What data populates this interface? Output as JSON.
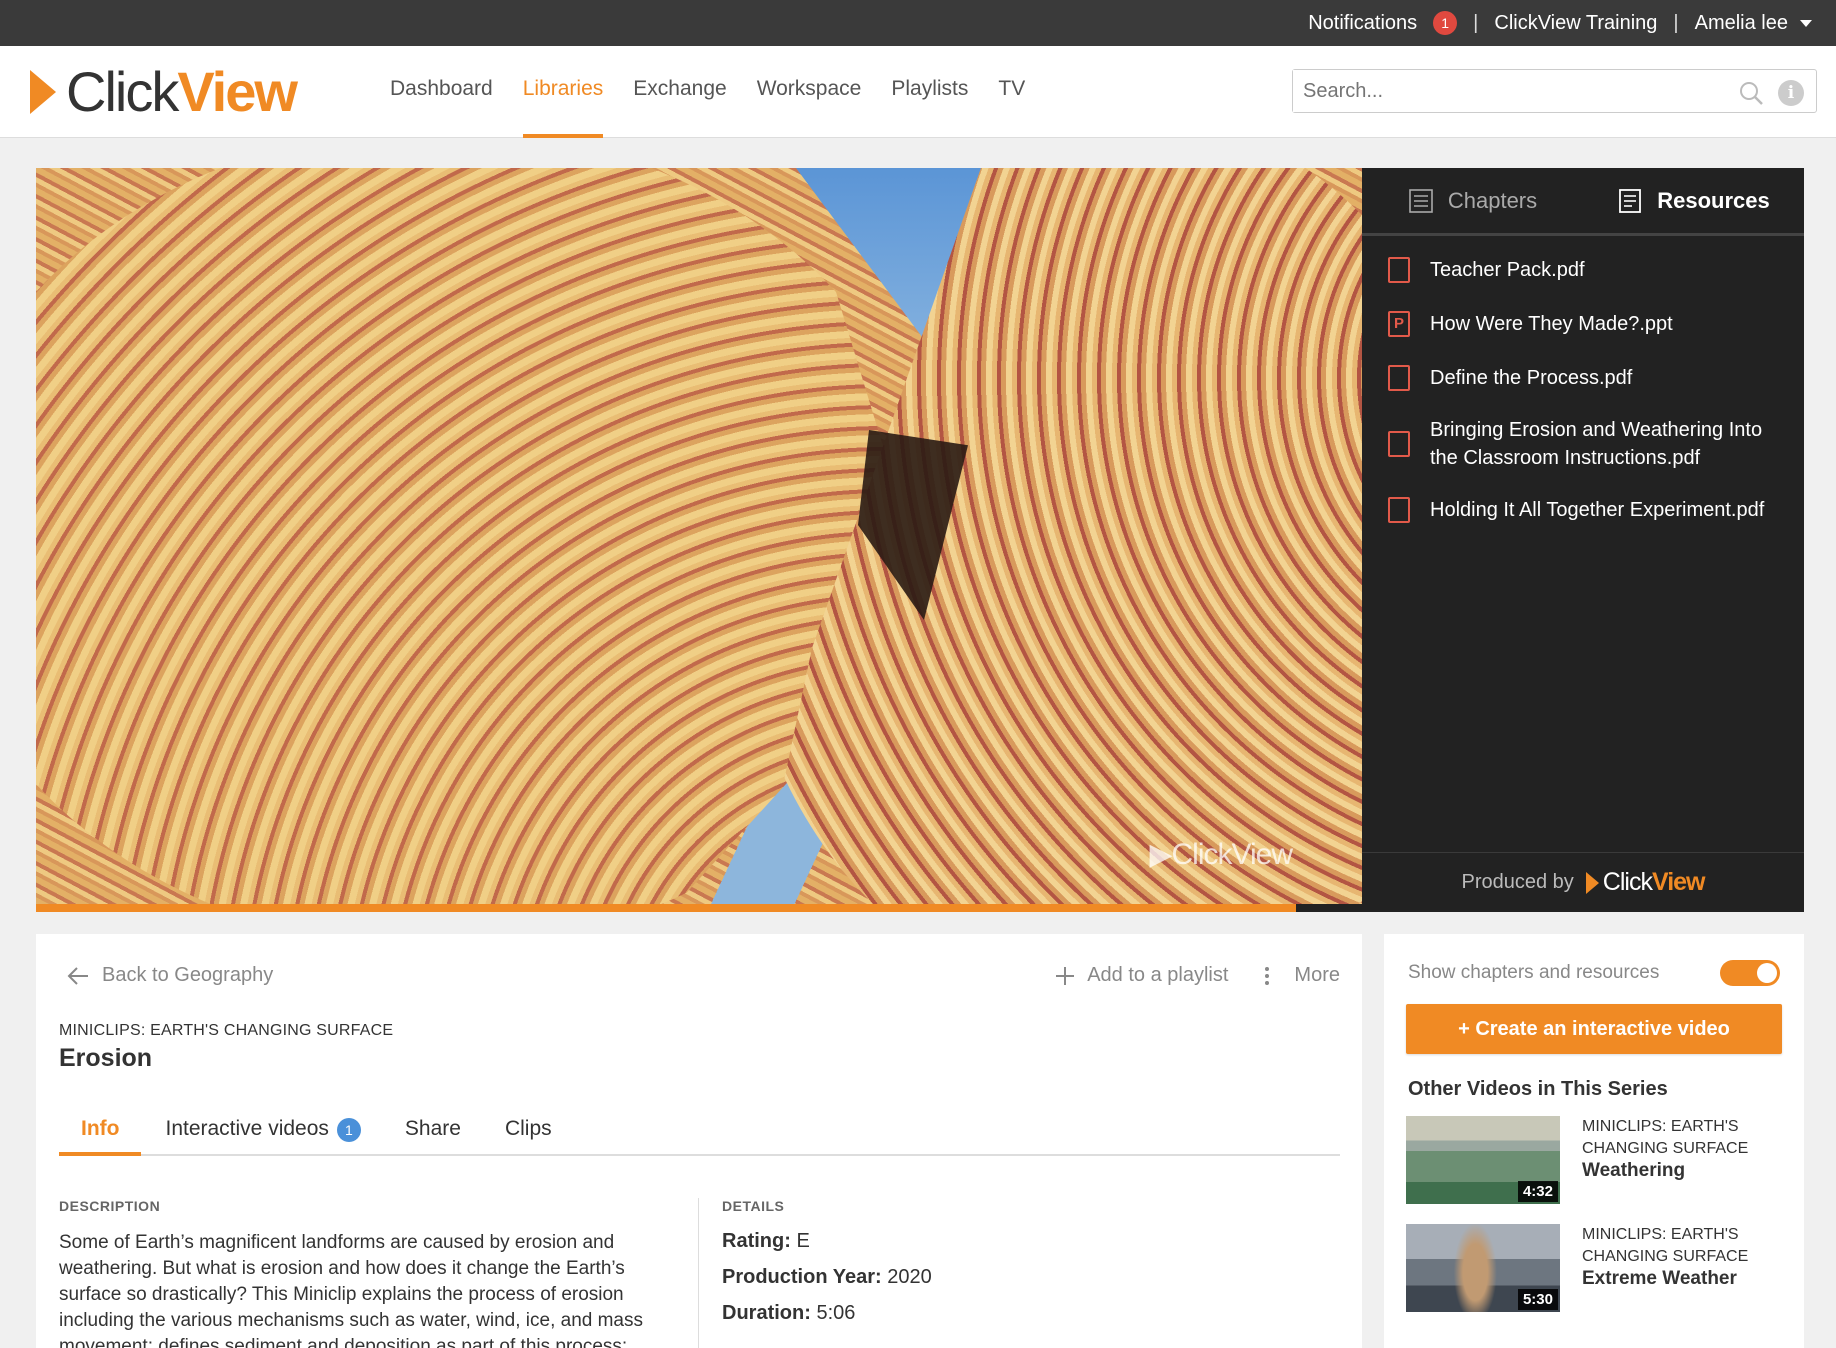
{
  "topbar": {
    "notifications_label": "Notifications",
    "notifications_count": "1",
    "org": "ClickView Training",
    "user": "Amelia lee"
  },
  "header": {
    "logo_click": "Click",
    "logo_view": "View",
    "nav": [
      "Dashboard",
      "Libraries",
      "Exchange",
      "Workspace",
      "Playlists",
      "TV"
    ],
    "active_nav": "Libraries",
    "search_placeholder": "Search..."
  },
  "player": {
    "watermark": "ClickView",
    "progress": 0.95
  },
  "panel": {
    "tabs": [
      "Chapters",
      "Resources"
    ],
    "active_tab": "Resources",
    "resources": [
      {
        "name": "Teacher Pack.pdf",
        "type": "pdf"
      },
      {
        "name": "How Were They Made?.ppt",
        "type": "ppt"
      },
      {
        "name": "Define the Process.pdf",
        "type": "pdf"
      },
      {
        "name": "Bringing Erosion and Weathering Into the Classroom Instructions.pdf",
        "type": "pdf"
      },
      {
        "name": "Holding It All Together Experiment.pdf",
        "type": "pdf"
      }
    ],
    "produced_by": "Produced by",
    "producer_click": "Click",
    "producer_view": "View"
  },
  "info": {
    "back": "Back to Geography",
    "add_playlist": "Add to a playlist",
    "more": "More",
    "series": "MINICLIPS: EARTH'S CHANGING SURFACE",
    "title": "Erosion",
    "tabs": [
      "Info",
      "Interactive videos",
      "Share",
      "Clips"
    ],
    "interactive_count": "1",
    "description_heading": "DESCRIPTION",
    "description": "Some of Earth’s magnificent landforms are caused by erosion and weathering. But what is erosion and how does it change the Earth’s surface so drastically? This Miniclip explains the process of erosion including the various mechanisms such as water, wind, ice, and mass movement; defines sediment and deposition as part of this process;",
    "details_heading": "DETAILS",
    "rating_label": "Rating:",
    "rating": "E",
    "year_label": "Production Year:",
    "year": "2020",
    "duration_label": "Duration:",
    "duration": "5:06"
  },
  "side": {
    "toggle_label": "Show chapters and resources",
    "toggle_on": true,
    "create_label": "+ Create an interactive video",
    "other_heading": "Other Videos in This Series",
    "videos": [
      {
        "series": "MINICLIPS: EARTH'S CHANGING SURFACE",
        "title": "Weathering",
        "duration": "4:32"
      },
      {
        "series": "MINICLIPS: EARTH'S CHANGING SURFACE",
        "title": "Extreme Weather",
        "duration": "5:30"
      }
    ]
  },
  "colors": {
    "accent": "#f08a24",
    "topbar": "#3a3a3a",
    "panel": "#222222",
    "badge_red": "#e0493f",
    "badge_blue": "#4a90d9"
  }
}
